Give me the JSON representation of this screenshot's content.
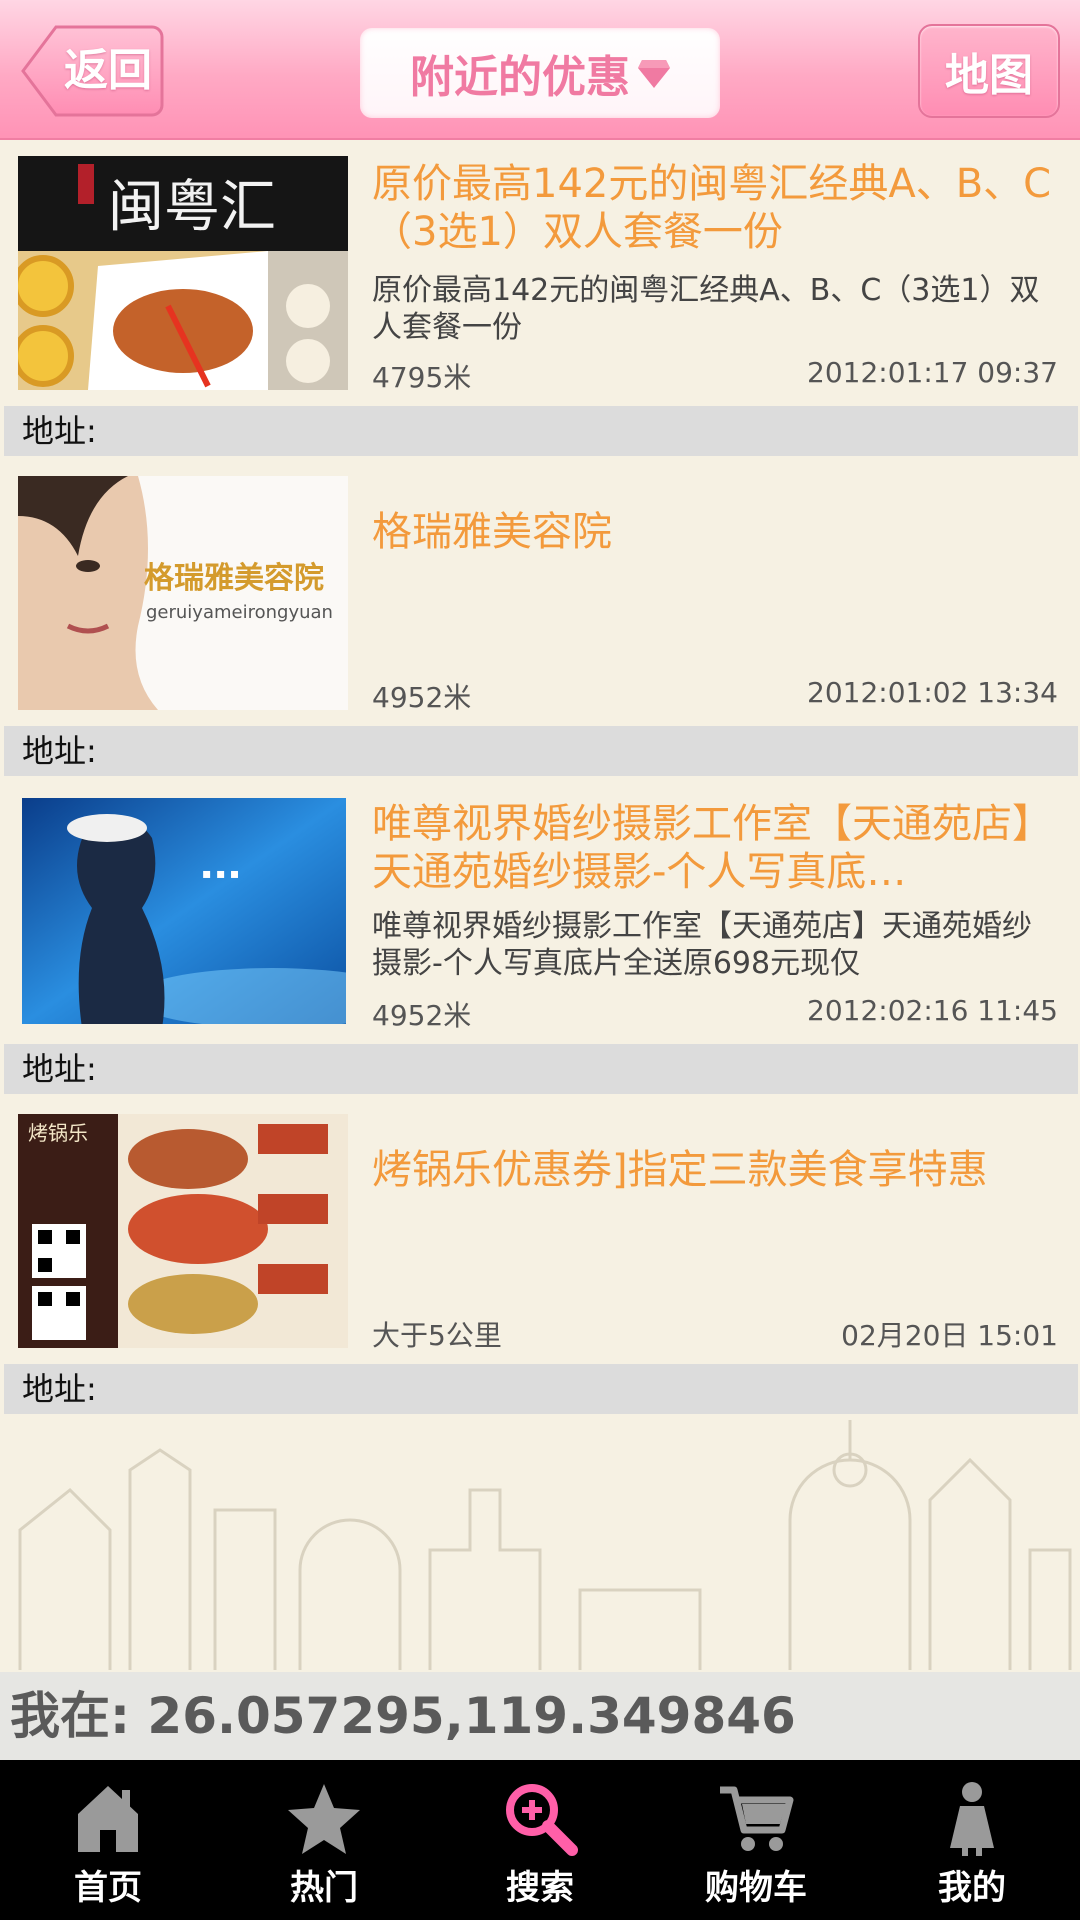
{
  "header": {
    "back_label": "返回",
    "title": "附近的优惠",
    "map_label": "地图"
  },
  "items": [
    {
      "title": "原价最高142元的闽粤汇经典A、B、C（3选1）双人套餐一份",
      "desc": "原价最高142元的闽粤汇经典A、B、C（3选1）双人套餐一份",
      "distance": "4795米",
      "time": "2012:01:17 09:37",
      "address_label": "地址:",
      "thumb_text": "闽粤汇"
    },
    {
      "title": "格瑞雅美容院",
      "desc": "",
      "distance": "4952米",
      "time": "2012:01:02 13:34",
      "address_label": "地址:",
      "thumb_text": "格瑞雅美容院",
      "thumb_sub": "geruiyameirongyuan"
    },
    {
      "title": "唯尊视界婚纱摄影工作室【天通苑店】天通苑婚纱摄影-个人写真底…",
      "desc": "唯尊视界婚纱摄影工作室【天通苑店】天通苑婚纱摄影-个人写真底片全送原698元现仅",
      "distance": "4952米",
      "time": "2012:02:16 11:45",
      "address_label": "地址:"
    },
    {
      "title": "烤锅乐优惠券]指定三款美食享特惠",
      "desc": "",
      "distance": "大于5公里",
      "time": "02月20日 15:01",
      "address_label": "地址:",
      "thumb_text": "烤锅乐"
    }
  ],
  "location": {
    "label": "我在: 26.057295,119.349846"
  },
  "nav": [
    {
      "label": "首页",
      "icon": "home-icon",
      "active": false
    },
    {
      "label": "热门",
      "icon": "star-icon",
      "active": false
    },
    {
      "label": "搜索",
      "icon": "search-icon",
      "active": true
    },
    {
      "label": "购物车",
      "icon": "cart-icon",
      "active": false
    },
    {
      "label": "我的",
      "icon": "person-icon",
      "active": false
    }
  ],
  "colors": {
    "header_pink": "#ff9dbd",
    "title_orange": "#f39a3c",
    "active_nav": "#ff5fa8"
  }
}
